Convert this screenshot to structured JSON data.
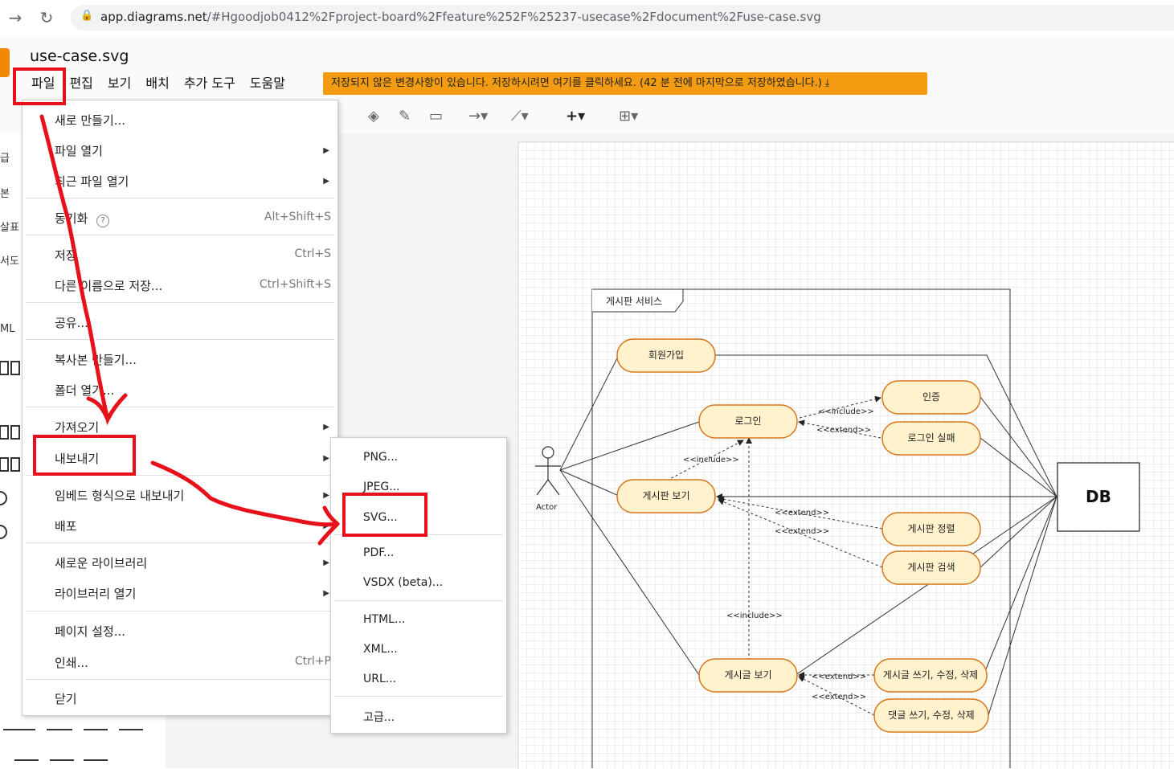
{
  "browser": {
    "url_host": "app.diagrams.net",
    "url_path": "/#Hgoodjob0412%2Fproject-board%2Ffeature%252F%25237-usecase%2Fdocument%2Fuse-case.svg"
  },
  "app": {
    "filename": "use-case.svg",
    "menus": [
      "파일",
      "편집",
      "보기",
      "배치",
      "추가 도구",
      "도움말"
    ],
    "unsaved_notice": "저장되지 않은 변경사항이 있습니다. 저장하시려면 여기를 클릭하세요. (42 분 전에 마지막으로 저장하였습니다.)"
  },
  "left_panel": {
    "fragments": [
      "급",
      "본",
      "살표",
      "서도",
      "ML"
    ]
  },
  "file_menu": {
    "items": [
      {
        "label": "새로 만들기...",
        "shortcut": "",
        "submenu": false
      },
      {
        "label": "파일 열기",
        "shortcut": "",
        "submenu": true
      },
      {
        "label": "최근 파일 열기",
        "shortcut": "",
        "submenu": true
      },
      {
        "label": "동기화",
        "shortcut": "Alt+Shift+S",
        "submenu": false
      },
      {
        "label": "저장",
        "shortcut": "Ctrl+S",
        "submenu": false
      },
      {
        "label": "다른 이름으로 저장...",
        "shortcut": "Ctrl+Shift+S",
        "submenu": false
      },
      {
        "label": "공유...",
        "shortcut": "",
        "submenu": false
      },
      {
        "label": "복사본 만들기...",
        "shortcut": "",
        "submenu": false
      },
      {
        "label": "폴더 열기...",
        "shortcut": "",
        "submenu": false
      },
      {
        "label": "가져오기",
        "shortcut": "",
        "submenu": true
      },
      {
        "label": "내보내기",
        "shortcut": "",
        "submenu": true
      },
      {
        "label": "임베드 형식으로 내보내기",
        "shortcut": "",
        "submenu": true
      },
      {
        "label": "배포",
        "shortcut": "",
        "submenu": true
      },
      {
        "label": "새로운 라이브러리",
        "shortcut": "",
        "submenu": true
      },
      {
        "label": "라이브러리 열기",
        "shortcut": "",
        "submenu": true
      },
      {
        "label": "페이지 설정...",
        "shortcut": "",
        "submenu": false
      },
      {
        "label": "인쇄...",
        "shortcut": "Ctrl+P",
        "submenu": false
      },
      {
        "label": "닫기",
        "shortcut": "",
        "submenu": false
      }
    ]
  },
  "export_menu": {
    "items": [
      "PNG...",
      "JPEG...",
      "SVG...",
      "PDF...",
      "VSDX (beta)...",
      "HTML...",
      "XML...",
      "URL...",
      "고급..."
    ]
  },
  "diagram": {
    "frame_title": "게시판 서비스",
    "actor": "Actor",
    "db": "DB",
    "usecases": {
      "signup": "회원가입",
      "login": "로그인",
      "auth": "인증",
      "login_fail": "로그인 실패",
      "board_view": "게시판 보기",
      "board_sort": "게시판 정렬",
      "board_search": "게시판 검색",
      "post_view": "게시글 보기",
      "post_write": "게시글 쓰기, 수정, 삭제",
      "comment_write": "댓글 쓰기, 수정, 삭제"
    },
    "labels": {
      "include": "<<include>>",
      "extend": "<<extend>>"
    }
  }
}
